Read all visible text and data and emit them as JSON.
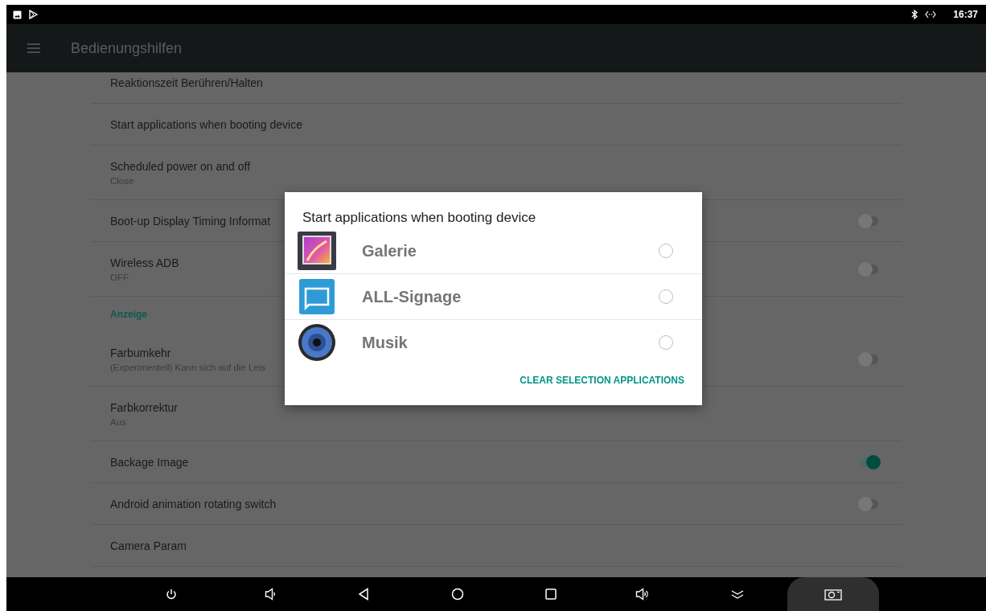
{
  "status_bar": {
    "time": "16:37"
  },
  "toolbar": {
    "title": "Bedienungshilfen"
  },
  "settings": [
    {
      "kind": "setting",
      "title": "Reaktionszeit Berühren/Halten"
    },
    {
      "kind": "setting",
      "title": "Start applications when booting device"
    },
    {
      "kind": "setting",
      "title": "Scheduled power on and off",
      "summary": "Close"
    },
    {
      "kind": "setting",
      "title": "Boot-up Display Timing Informat",
      "switch": {
        "on": false
      }
    },
    {
      "kind": "setting",
      "title": "Wireless ADB",
      "summary": "OFF",
      "switch": {
        "on": false
      }
    },
    {
      "kind": "category",
      "title": "Anzeige"
    },
    {
      "kind": "setting",
      "title": "Farbumkehr",
      "summary": "(Experimentell) Kann sich auf die Leis",
      "switch": {
        "on": false
      }
    },
    {
      "kind": "setting",
      "title": "Farbkorrektur",
      "summary": "Aus"
    },
    {
      "kind": "setting",
      "title": "Backage Image",
      "switch": {
        "on": true
      }
    },
    {
      "kind": "setting",
      "title": "Android animation rotating switch",
      "switch": {
        "on": false
      }
    },
    {
      "kind": "setting",
      "title": "Camera Param"
    }
  ],
  "dialog": {
    "title": "Start applications when booting device",
    "apps": [
      {
        "kind": "gallery",
        "label": "Galerie",
        "selected": false
      },
      {
        "kind": "signage",
        "label": "ALL-Signage",
        "selected": false
      },
      {
        "kind": "music",
        "label": "Musik",
        "selected": false
      }
    ],
    "button": "CLEAR SELECTION APPLICATIONS"
  }
}
